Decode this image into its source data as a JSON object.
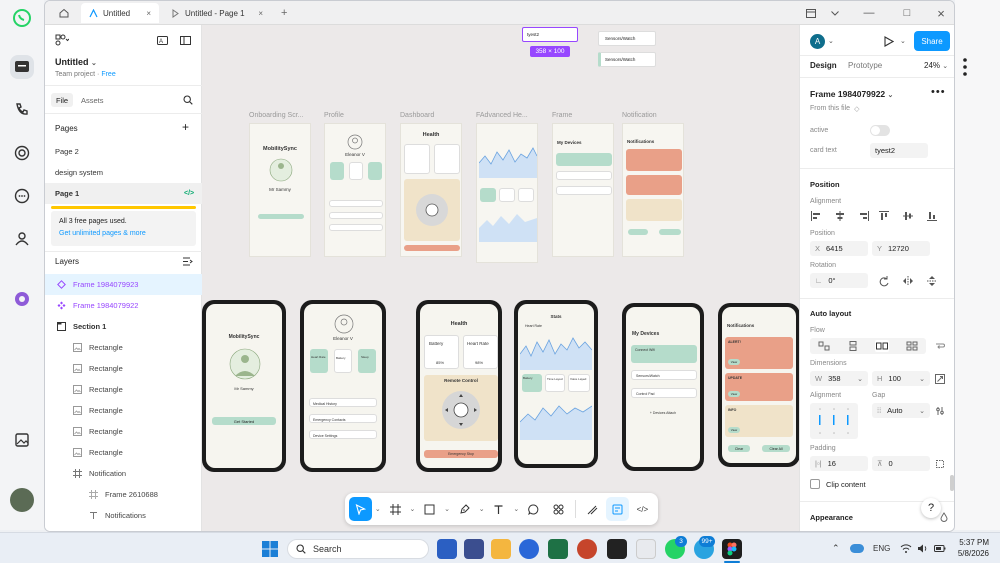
{
  "window": {
    "tabs": [
      {
        "label": "Untitled",
        "close": "×"
      },
      {
        "label": "Untitled - Page 1",
        "close": "×"
      }
    ],
    "add_tab": "+",
    "controls": {
      "minimize": "—",
      "maximize": "□",
      "close": "×"
    }
  },
  "left_panel": {
    "file_name": "Untitled",
    "team": "Team project",
    "plan": "Free",
    "tabs": [
      "File",
      "Assets"
    ],
    "pages_title": "Pages",
    "add_page": "+",
    "pages": [
      "Page 2",
      "design system",
      "Page 1"
    ],
    "free_notice": "All 3 free pages used.",
    "unlimited_link": "Get unlimited pages & more",
    "layers_title": "Layers",
    "layers": [
      {
        "label": "Frame 1984079923",
        "type": "component"
      },
      {
        "label": "Frame 1984079922",
        "type": "component"
      },
      {
        "label": "Section 1",
        "type": "section"
      },
      {
        "label": "Rectangle",
        "type": "rect"
      },
      {
        "label": "Rectangle",
        "type": "rect"
      },
      {
        "label": "Rectangle",
        "type": "rect"
      },
      {
        "label": "Rectangle",
        "type": "rect"
      },
      {
        "label": "Rectangle",
        "type": "rect"
      },
      {
        "label": "Rectangle",
        "type": "rect"
      },
      {
        "label": "Notification",
        "type": "frame"
      },
      {
        "label": "Frame 2610688",
        "type": "frame"
      },
      {
        "label": "Notifications",
        "type": "text"
      }
    ]
  },
  "canvas": {
    "frame_labels": [
      "Onboarding Scr...",
      "Profile",
      "Dashboard",
      "FAdvanced He...",
      "Frame",
      "Notification"
    ],
    "selected_component": "tyest2",
    "size_badge": "358 × 100",
    "component_buttons": [
      "Sensors/Watch",
      "Sensors/Watch"
    ],
    "screens": {
      "onboard_title": "MobilitySync",
      "onboard_sub": "Mr Sammy",
      "onboard_btn": "Get Started",
      "profile_name": "Eleanor V",
      "profile_items": [
        "Medical History",
        "Emergency Contacts",
        "Device Settings"
      ],
      "profile_cards": [
        "Heart Rate",
        "Battery",
        "Sleep"
      ],
      "health_title": "Health",
      "battery_label": "Battery",
      "battery_val": "85%",
      "heart_label": "Heart Rate",
      "heart_val": "98%",
      "remote_title": "Remote Control",
      "emergency": "Emergency Stop",
      "stats_title": "Stats",
      "stats_sub": "Heart Rate",
      "stats_labels": [
        "Battery",
        "Time Layed",
        "Voice Layed"
      ],
      "devices_title": "My Devices",
      "devices": [
        "Connect Wifi",
        "Sensors/Watch",
        "Control Pad"
      ],
      "devices_link": "+ Devices Attach",
      "notif_title": "Notifications",
      "notif_items": [
        "ALERT!",
        "UPDATE",
        "INFO"
      ],
      "notif_btn": "View",
      "notif_clear": "Clear",
      "notif_clear_all": "Clear All"
    }
  },
  "right_panel": {
    "avatar": "A",
    "share": "Share",
    "tabs": [
      "Design",
      "Prototype"
    ],
    "zoom": "24%",
    "frame_name": "Frame 1984079922",
    "from_file": "From this file",
    "prop_active": "active",
    "prop_card_text": "card text",
    "card_text_value": "tyest2",
    "position_title": "Position",
    "alignment_label": "Alignment",
    "position_label": "Position",
    "x_label": "X",
    "x_value": "6415",
    "y_label": "Y",
    "y_value": "12720",
    "rotation_label": "Rotation",
    "rotation_value": "0°",
    "autolayout_title": "Auto layout",
    "flow_label": "Flow",
    "dimensions_label": "Dimensions",
    "w_label": "W",
    "w_value": "358",
    "h_label": "H",
    "h_value": "100",
    "align_label": "Alignment",
    "gap_label": "Gap",
    "gap_value": "Auto",
    "padding_label": "Padding",
    "pad_h": "16",
    "pad_v": "0",
    "clip_label": "Clip content",
    "appearance_title": "Appearance",
    "help": "?"
  },
  "taskbar": {
    "search": "Search",
    "badge_1": "3",
    "badge_2": "99+",
    "lang": "ENG",
    "time": "5:37 PM",
    "date": "5/8/2026"
  },
  "colors": {
    "accent": "#0d99ff",
    "purple": "#9747ff",
    "mint": "#b5dccb",
    "salmon": "#e9a088",
    "beige": "#f0e3c9"
  }
}
